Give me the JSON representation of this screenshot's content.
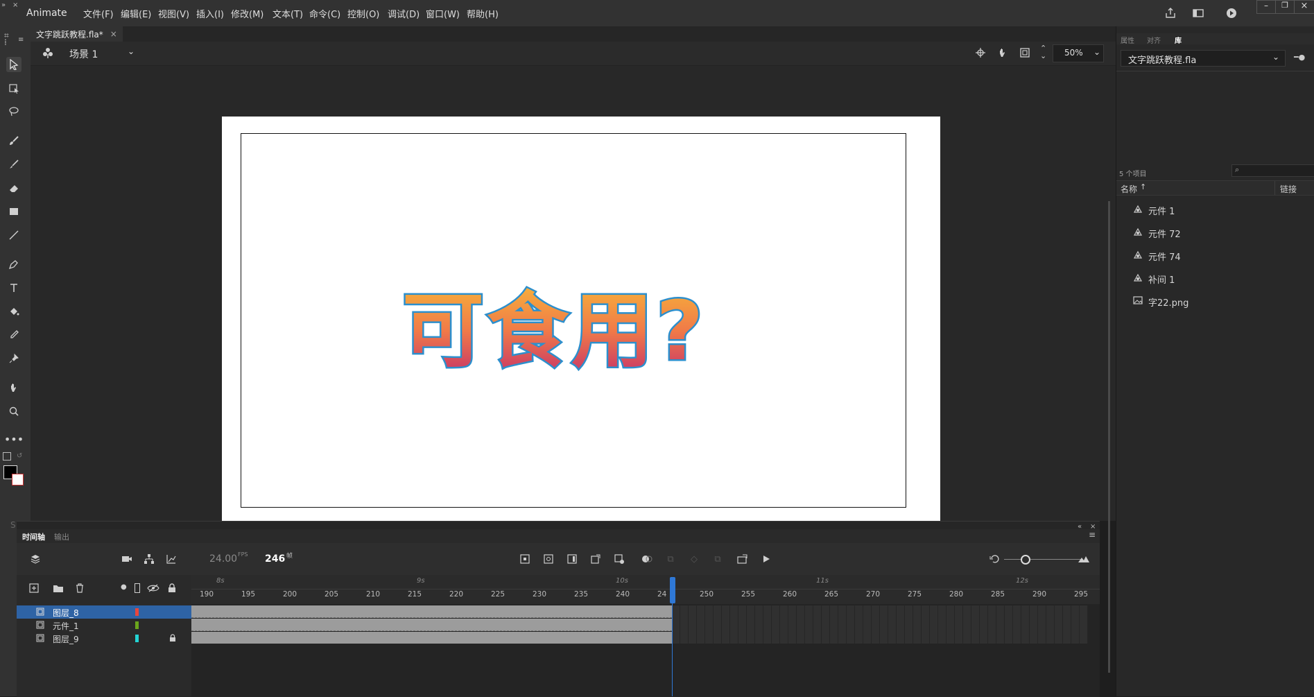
{
  "app": {
    "name": "Animate"
  },
  "menu": [
    "文件(F)",
    "编辑(E)",
    "视图(V)",
    "插入(I)",
    "修改(M)",
    "文本(T)",
    "命令(C)",
    "控制(O)",
    "调试(D)",
    "窗口(W)",
    "帮助(H)"
  ],
  "document": {
    "tab_title": "文字跳跃教程.fla*",
    "close": "×"
  },
  "scene": {
    "label": "场景 1",
    "zoom": "50%"
  },
  "stage": {
    "text": "可食用?"
  },
  "timeline": {
    "tabs": [
      "时间轴",
      "输出"
    ],
    "fps": "24.00",
    "fps_unit": "FPS",
    "frame": "246",
    "frame_unit": "帧",
    "seconds": [
      "8s",
      "9s",
      "10s",
      "11s",
      "12s"
    ],
    "ticks": [
      "190",
      "195",
      "200",
      "205",
      "210",
      "215",
      "220",
      "225",
      "230",
      "235",
      "240",
      "24",
      "250",
      "255",
      "260",
      "265",
      "270",
      "275",
      "280",
      "285",
      "290",
      "295"
    ],
    "layers": [
      {
        "name": "图层_8",
        "color": "#e8463c",
        "locked": false,
        "selected": true
      },
      {
        "name": "元件_1",
        "color": "#6aa51c",
        "locked": false,
        "selected": false
      },
      {
        "name": "图层_9",
        "color": "#23d4d4",
        "locked": true,
        "selected": false
      }
    ]
  },
  "panel": {
    "tabs": [
      "属性",
      "对齐",
      "库"
    ],
    "library_file": "文字跳跃教程.fla",
    "item_count": "5 个项目",
    "columns": {
      "name": "名称",
      "linkage": "链接"
    },
    "items": [
      {
        "name": "元件 1",
        "icon": "graphic-symbol-icon"
      },
      {
        "name": "元件 72",
        "icon": "graphic-symbol-icon"
      },
      {
        "name": "元件 74",
        "icon": "graphic-symbol-icon"
      },
      {
        "name": "补间 1",
        "icon": "graphic-symbol-icon"
      },
      {
        "name": "字22.png",
        "icon": "bitmap-icon"
      }
    ]
  },
  "colors": {
    "accent": "#2f78d6",
    "layer_selected": "#2e63a5",
    "frame_fill": "#9c9c9c",
    "text_outline": "#2c8fcd"
  }
}
